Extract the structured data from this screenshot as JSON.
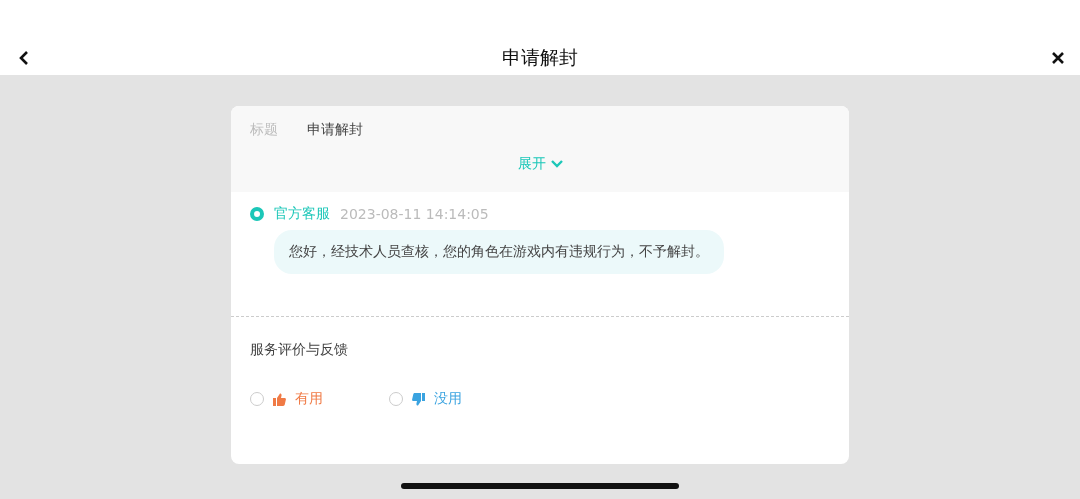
{
  "header": {
    "title": "申请解封"
  },
  "summary": {
    "label": "标题",
    "value": "申请解封",
    "toggle": "展开",
    "expanded": false
  },
  "messages": [
    {
      "sender": "官方客服",
      "time": "2023-08-11 14:14:05",
      "text": "您好，经技术人员查核，您的角色在游戏内有违规行为，不予解封。"
    }
  ],
  "feedback": {
    "title": "服务评价与反馈",
    "options": [
      {
        "kind": "up",
        "label": "有用",
        "selected": false,
        "color": "#f07a45"
      },
      {
        "kind": "down",
        "label": "没用",
        "selected": false,
        "color": "#3aa3e0"
      }
    ]
  }
}
